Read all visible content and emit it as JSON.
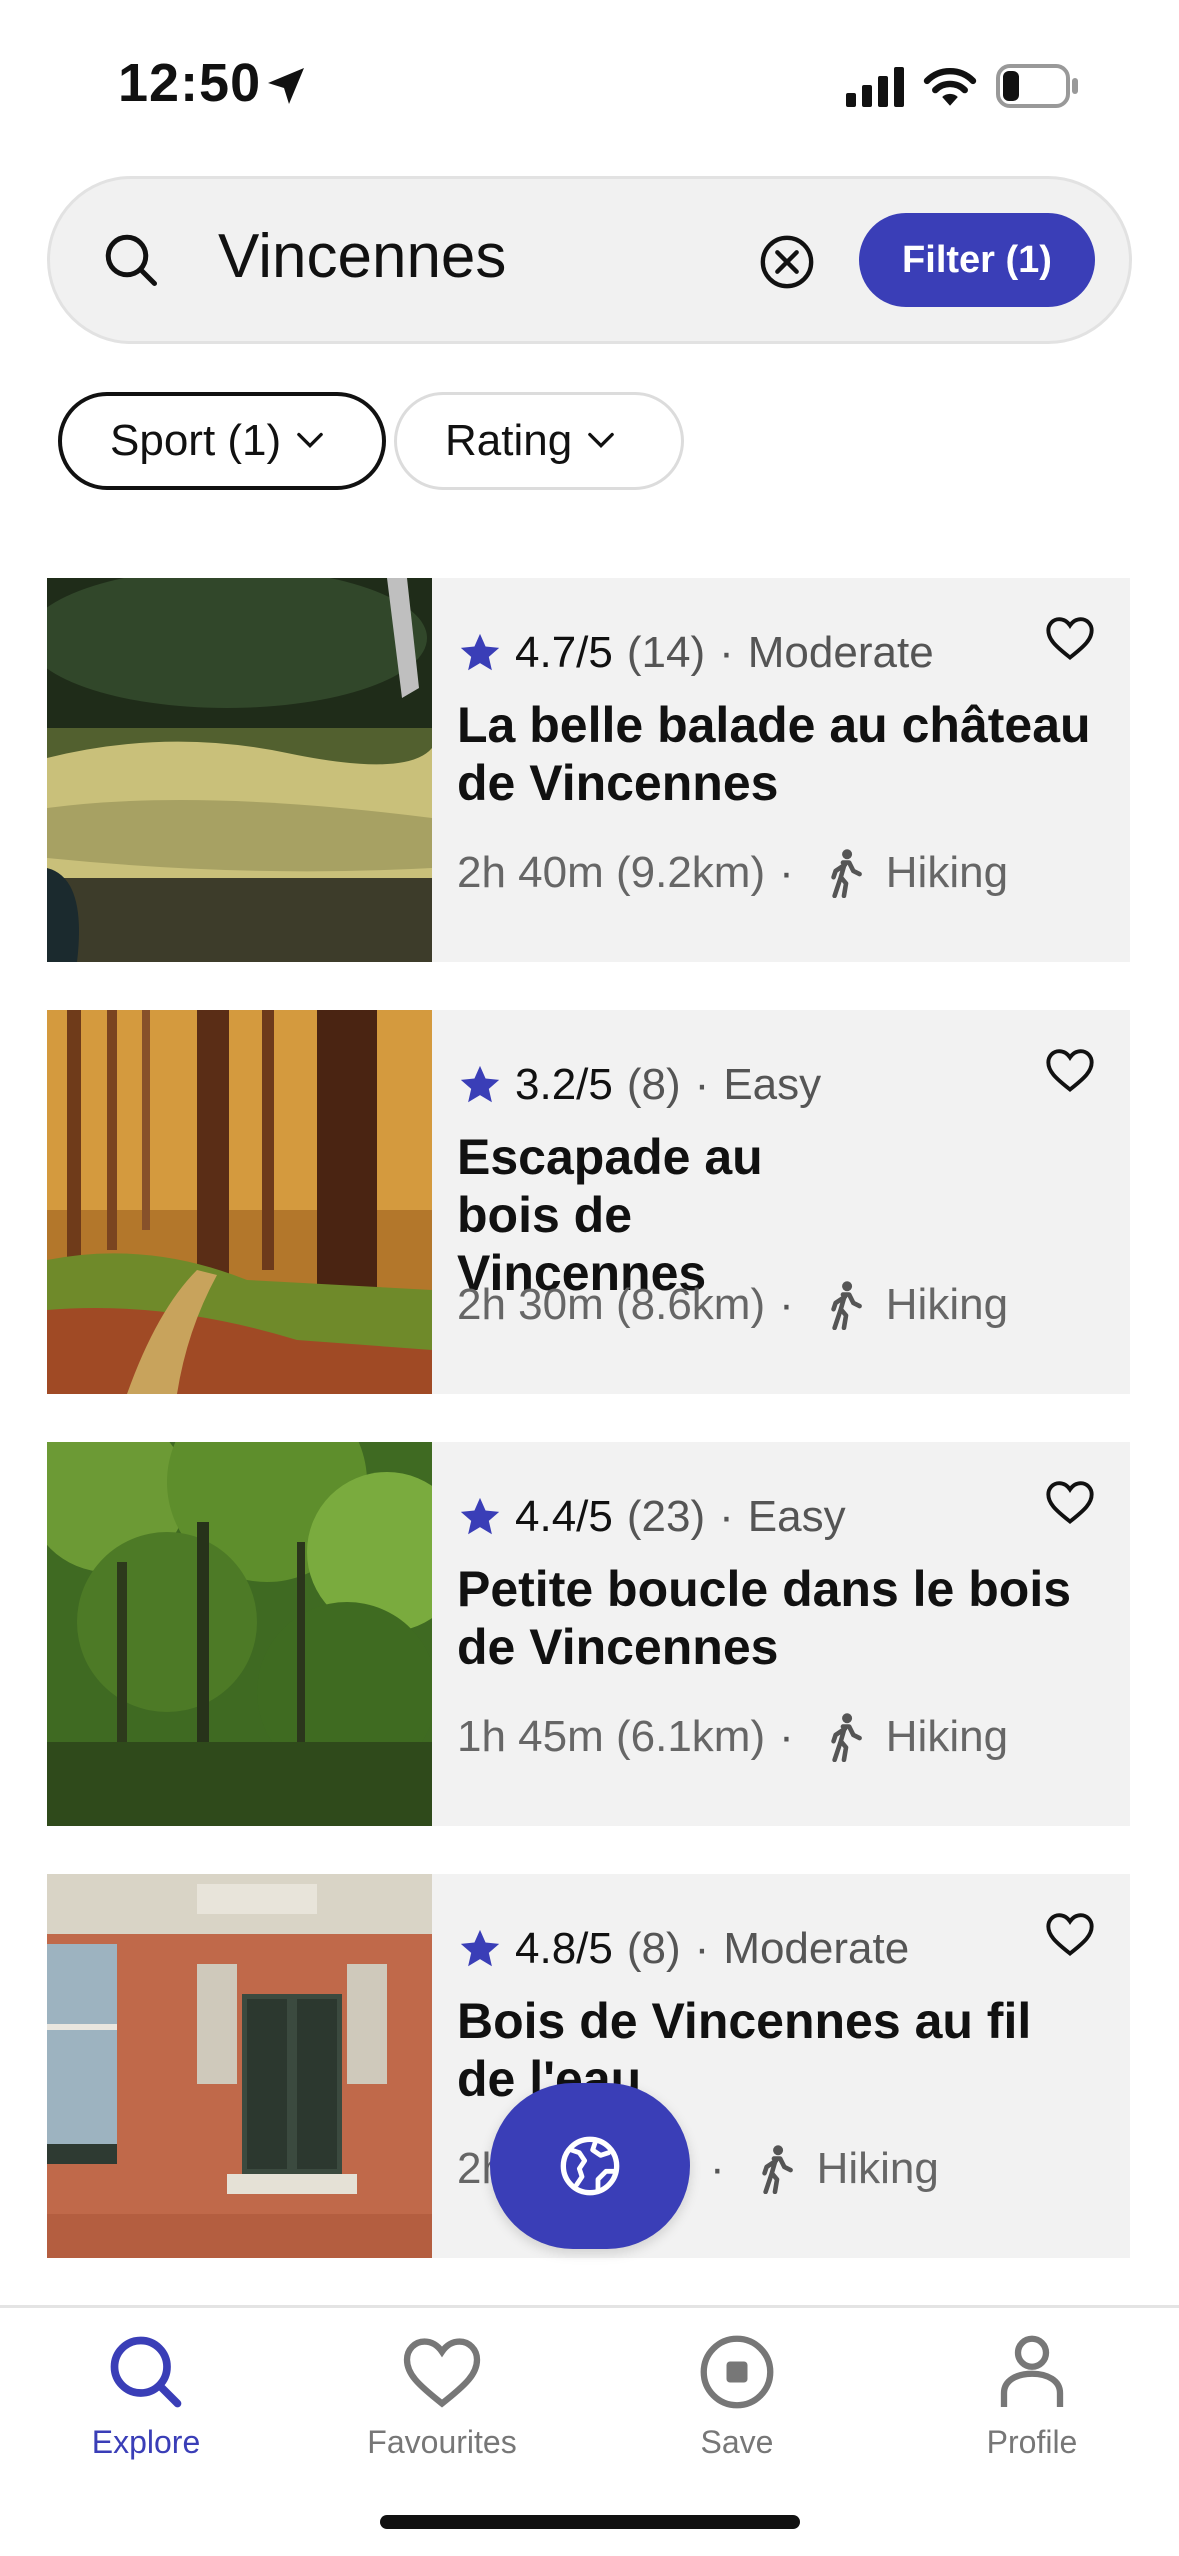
{
  "status_bar": {
    "time": "12:50",
    "battery_level": 0.25
  },
  "search": {
    "query": "Vincennes",
    "filter_label": "Filter (1)"
  },
  "chips": [
    {
      "label": "Sport (1)",
      "selected": true
    },
    {
      "label": "Rating",
      "selected": false
    }
  ],
  "cards": [
    {
      "rating": "4.7/5",
      "reviews": "(14)",
      "difficulty": "Moderate",
      "title": "La belle balade au château de Vincennes",
      "duration": "2h 40m (9.2km)",
      "sport": "Hiking",
      "image": "river-pond-photo"
    },
    {
      "rating": "3.2/5",
      "reviews": "(8)",
      "difficulty": "Easy",
      "title": "Escapade au bois de Vincennes",
      "duration": "2h 30m (8.6km)",
      "sport": "Hiking",
      "image": "pine-forest-photo"
    },
    {
      "rating": "4.4/5",
      "reviews": "(23)",
      "difficulty": "Easy",
      "title": "Petite boucle dans le bois de Vincennes",
      "duration": "1h 45m (6.1km)",
      "sport": "Hiking",
      "image": "green-woods-photo"
    },
    {
      "rating": "4.8/5",
      "reviews": "(8)",
      "difficulty": "Moderate",
      "title": "Bois de Vincennes au fil de l'eau",
      "duration": "2h",
      "sport": "Hiking",
      "image": "brick-building-photo"
    }
  ],
  "nav": {
    "explore": "Explore",
    "favourites": "Favourites",
    "save": "Save",
    "profile": "Profile"
  },
  "colors": {
    "accent": "#3a3eb7",
    "card_bg": "#f2f2f2",
    "text": "#111111",
    "muted": "#666666"
  }
}
